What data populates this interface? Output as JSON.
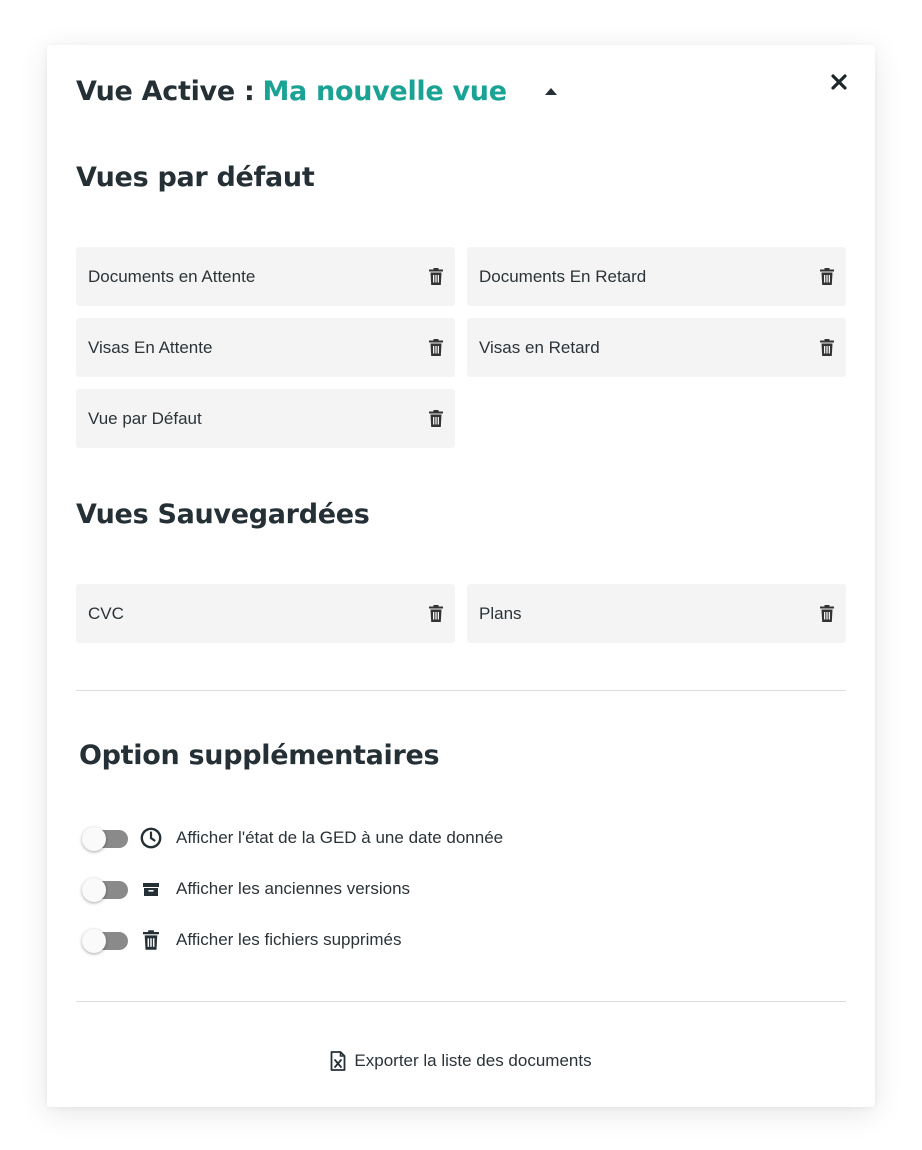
{
  "header": {
    "prefix": "Vue Active :",
    "active_view": "Ma nouvelle vue"
  },
  "default_views": {
    "title": "Vues par défaut",
    "items": [
      {
        "label": "Documents en Attente"
      },
      {
        "label": "Documents En Retard"
      },
      {
        "label": "Visas En Attente"
      },
      {
        "label": "Visas en Retard"
      },
      {
        "label": "Vue par Défaut"
      }
    ]
  },
  "saved_views": {
    "title": "Vues Sauvegardées",
    "items": [
      {
        "label": "CVC"
      },
      {
        "label": "Plans"
      }
    ]
  },
  "options": {
    "title": "Option supplémentaires",
    "items": [
      {
        "label": "Afficher l'état de la GED à une date donnée",
        "icon": "clock-icon",
        "enabled": false
      },
      {
        "label": "Afficher les anciennes versions",
        "icon": "archive-icon",
        "enabled": false
      },
      {
        "label": "Afficher les fichiers supprimés",
        "icon": "trash-icon",
        "enabled": false
      }
    ]
  },
  "footer": {
    "export_label": "Exporter la liste des documents",
    "export_icon": "file-excel-icon"
  },
  "colors": {
    "accent": "#1aa394",
    "text": "#253036",
    "tile_bg": "#f4f4f4"
  }
}
